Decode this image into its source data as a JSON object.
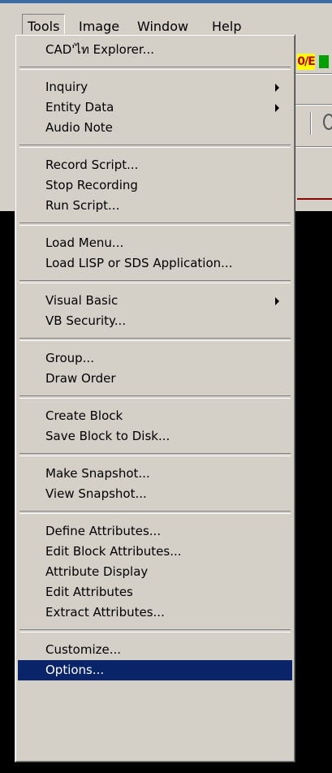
{
  "colors": {
    "menu_bg": "#d4d0c8",
    "highlight": "#0a246a",
    "title_bar": "#3a6ea5",
    "workspace": "#000000"
  },
  "menubar": {
    "items": [
      {
        "label": "Tools",
        "active": true
      },
      {
        "label": "Image"
      },
      {
        "label": "Window"
      },
      {
        "label": "Help"
      }
    ]
  },
  "background": {
    "toolbar_icon_text": "0/E"
  },
  "menu": {
    "groups": [
      [
        {
          "label": "CAD'ไท Explorer..."
        }
      ],
      [
        {
          "label": "Inquiry",
          "submenu": true
        },
        {
          "label": "Entity Data",
          "submenu": true
        },
        {
          "label": "Audio Note"
        }
      ],
      [
        {
          "label": "Record Script..."
        },
        {
          "label": "Stop Recording"
        },
        {
          "label": "Run Script..."
        }
      ],
      [
        {
          "label": "Load Menu..."
        },
        {
          "label": "Load LISP or SDS Application..."
        }
      ],
      [
        {
          "label": "Visual Basic",
          "submenu": true
        },
        {
          "label": "VB Security..."
        }
      ],
      [
        {
          "label": "Group..."
        },
        {
          "label": "Draw Order"
        }
      ],
      [
        {
          "label": "Create Block"
        },
        {
          "label": "Save Block to Disk..."
        }
      ],
      [
        {
          "label": "Make Snapshot..."
        },
        {
          "label": "View Snapshot..."
        }
      ],
      [
        {
          "label": "Define Attributes..."
        },
        {
          "label": "Edit Block Attributes..."
        },
        {
          "label": "Attribute Display"
        },
        {
          "label": "Edit Attributes"
        },
        {
          "label": "Extract Attributes..."
        }
      ],
      [
        {
          "label": "Customize..."
        },
        {
          "label": "Options...",
          "selected": true
        }
      ]
    ]
  }
}
